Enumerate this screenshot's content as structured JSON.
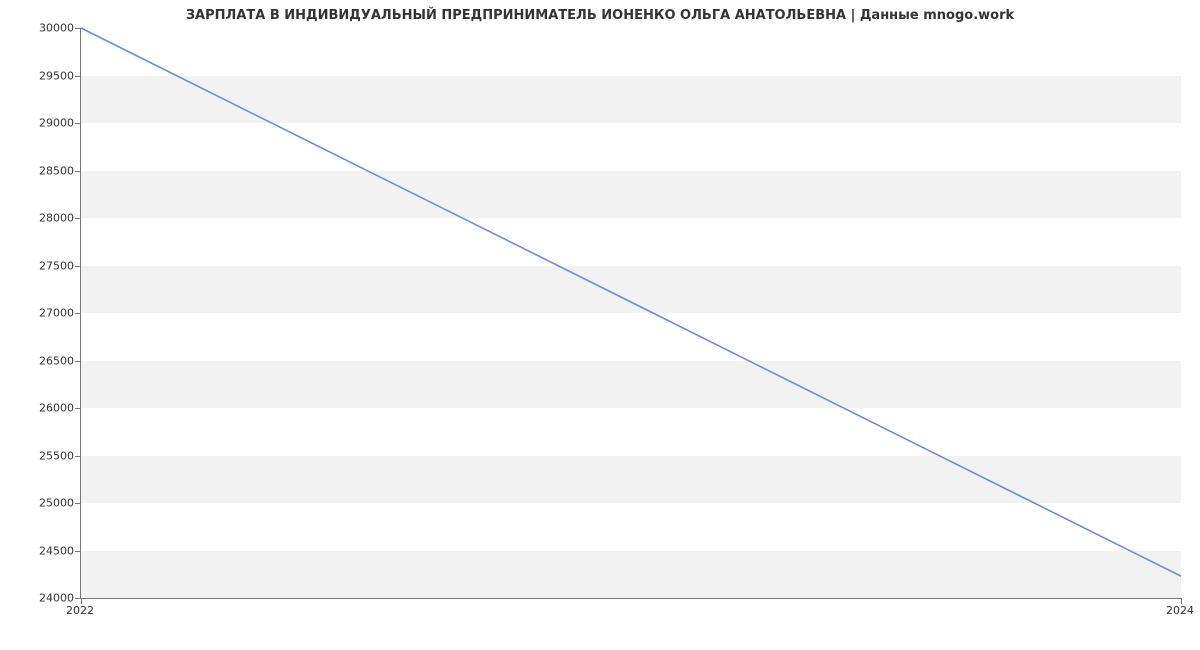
{
  "chart_data": {
    "type": "line",
    "title": "ЗАРПЛАТА В ИНДИВИДУАЛЬНЫЙ ПРЕДПРИНИМАТЕЛЬ ИОНЕНКО ОЛЬГА АНАТОЛЬЕВНА | Данные mnogo.work",
    "xlabel": "",
    "ylabel": "",
    "x": [
      2022,
      2024
    ],
    "values": [
      30000,
      24230
    ],
    "y_ticks": [
      24000,
      24500,
      25000,
      25500,
      26000,
      26500,
      27000,
      27500,
      28000,
      28500,
      29000,
      29500,
      30000
    ],
    "x_ticks": [
      2022,
      2024
    ],
    "ylim": [
      24000,
      30000
    ],
    "xlim": [
      2022,
      2024
    ],
    "grid": "banded"
  }
}
